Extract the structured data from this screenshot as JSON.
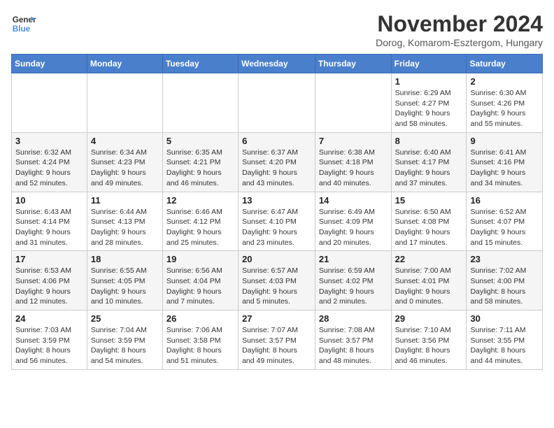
{
  "logo": {
    "line1": "General",
    "line2": "Blue"
  },
  "title": "November 2024",
  "subtitle": "Dorog, Komarom-Esztergom, Hungary",
  "days_header": [
    "Sunday",
    "Monday",
    "Tuesday",
    "Wednesday",
    "Thursday",
    "Friday",
    "Saturday"
  ],
  "weeks": [
    [
      {
        "day": "",
        "info": ""
      },
      {
        "day": "",
        "info": ""
      },
      {
        "day": "",
        "info": ""
      },
      {
        "day": "",
        "info": ""
      },
      {
        "day": "",
        "info": ""
      },
      {
        "day": "1",
        "info": "Sunrise: 6:29 AM\nSunset: 4:27 PM\nDaylight: 9 hours and 58 minutes."
      },
      {
        "day": "2",
        "info": "Sunrise: 6:30 AM\nSunset: 4:26 PM\nDaylight: 9 hours and 55 minutes."
      }
    ],
    [
      {
        "day": "3",
        "info": "Sunrise: 6:32 AM\nSunset: 4:24 PM\nDaylight: 9 hours and 52 minutes."
      },
      {
        "day": "4",
        "info": "Sunrise: 6:34 AM\nSunset: 4:23 PM\nDaylight: 9 hours and 49 minutes."
      },
      {
        "day": "5",
        "info": "Sunrise: 6:35 AM\nSunset: 4:21 PM\nDaylight: 9 hours and 46 minutes."
      },
      {
        "day": "6",
        "info": "Sunrise: 6:37 AM\nSunset: 4:20 PM\nDaylight: 9 hours and 43 minutes."
      },
      {
        "day": "7",
        "info": "Sunrise: 6:38 AM\nSunset: 4:18 PM\nDaylight: 9 hours and 40 minutes."
      },
      {
        "day": "8",
        "info": "Sunrise: 6:40 AM\nSunset: 4:17 PM\nDaylight: 9 hours and 37 minutes."
      },
      {
        "day": "9",
        "info": "Sunrise: 6:41 AM\nSunset: 4:16 PM\nDaylight: 9 hours and 34 minutes."
      }
    ],
    [
      {
        "day": "10",
        "info": "Sunrise: 6:43 AM\nSunset: 4:14 PM\nDaylight: 9 hours and 31 minutes."
      },
      {
        "day": "11",
        "info": "Sunrise: 6:44 AM\nSunset: 4:13 PM\nDaylight: 9 hours and 28 minutes."
      },
      {
        "day": "12",
        "info": "Sunrise: 6:46 AM\nSunset: 4:12 PM\nDaylight: 9 hours and 25 minutes."
      },
      {
        "day": "13",
        "info": "Sunrise: 6:47 AM\nSunset: 4:10 PM\nDaylight: 9 hours and 23 minutes."
      },
      {
        "day": "14",
        "info": "Sunrise: 6:49 AM\nSunset: 4:09 PM\nDaylight: 9 hours and 20 minutes."
      },
      {
        "day": "15",
        "info": "Sunrise: 6:50 AM\nSunset: 4:08 PM\nDaylight: 9 hours and 17 minutes."
      },
      {
        "day": "16",
        "info": "Sunrise: 6:52 AM\nSunset: 4:07 PM\nDaylight: 9 hours and 15 minutes."
      }
    ],
    [
      {
        "day": "17",
        "info": "Sunrise: 6:53 AM\nSunset: 4:06 PM\nDaylight: 9 hours and 12 minutes."
      },
      {
        "day": "18",
        "info": "Sunrise: 6:55 AM\nSunset: 4:05 PM\nDaylight: 9 hours and 10 minutes."
      },
      {
        "day": "19",
        "info": "Sunrise: 6:56 AM\nSunset: 4:04 PM\nDaylight: 9 hours and 7 minutes."
      },
      {
        "day": "20",
        "info": "Sunrise: 6:57 AM\nSunset: 4:03 PM\nDaylight: 9 hours and 5 minutes."
      },
      {
        "day": "21",
        "info": "Sunrise: 6:59 AM\nSunset: 4:02 PM\nDaylight: 9 hours and 2 minutes."
      },
      {
        "day": "22",
        "info": "Sunrise: 7:00 AM\nSunset: 4:01 PM\nDaylight: 9 hours and 0 minutes."
      },
      {
        "day": "23",
        "info": "Sunrise: 7:02 AM\nSunset: 4:00 PM\nDaylight: 8 hours and 58 minutes."
      }
    ],
    [
      {
        "day": "24",
        "info": "Sunrise: 7:03 AM\nSunset: 3:59 PM\nDaylight: 8 hours and 56 minutes."
      },
      {
        "day": "25",
        "info": "Sunrise: 7:04 AM\nSunset: 3:59 PM\nDaylight: 8 hours and 54 minutes."
      },
      {
        "day": "26",
        "info": "Sunrise: 7:06 AM\nSunset: 3:58 PM\nDaylight: 8 hours and 51 minutes."
      },
      {
        "day": "27",
        "info": "Sunrise: 7:07 AM\nSunset: 3:57 PM\nDaylight: 8 hours and 49 minutes."
      },
      {
        "day": "28",
        "info": "Sunrise: 7:08 AM\nSunset: 3:57 PM\nDaylight: 8 hours and 48 minutes."
      },
      {
        "day": "29",
        "info": "Sunrise: 7:10 AM\nSunset: 3:56 PM\nDaylight: 8 hours and 46 minutes."
      },
      {
        "day": "30",
        "info": "Sunrise: 7:11 AM\nSunset: 3:55 PM\nDaylight: 8 hours and 44 minutes."
      }
    ]
  ]
}
